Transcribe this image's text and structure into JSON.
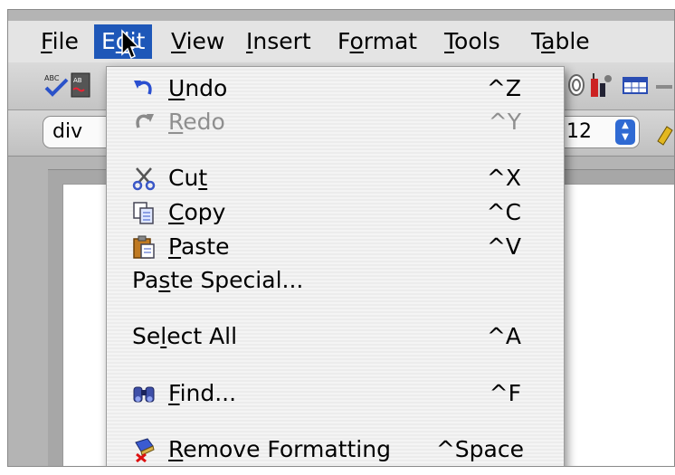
{
  "menubar": {
    "items": [
      {
        "pre": "",
        "u": "F",
        "post": "ile"
      },
      {
        "pre": "E",
        "u": "d",
        "post": "it"
      },
      {
        "pre": "",
        "u": "V",
        "post": "iew"
      },
      {
        "pre": "",
        "u": "I",
        "post": "nsert"
      },
      {
        "pre": "F",
        "u": "o",
        "post": "rmat"
      },
      {
        "pre": "",
        "u": "T",
        "post": "ools"
      },
      {
        "pre": "T",
        "u": "a",
        "post": "ble"
      }
    ],
    "active_index": 1
  },
  "toolbar": {
    "style_value": "div",
    "font_size_value": "12"
  },
  "edit_menu": {
    "items": [
      {
        "icon": "undo-icon",
        "pre": "",
        "u": "U",
        "post": "ndo",
        "shortcut": "^Z",
        "enabled": true
      },
      {
        "icon": "redo-icon",
        "pre": "",
        "u": "R",
        "post": "edo",
        "shortcut": "^Y",
        "enabled": false
      },
      {
        "icon": "scissors-icon",
        "pre": "Cu",
        "u": "t",
        "post": "",
        "shortcut": "^X",
        "enabled": true
      },
      {
        "icon": "copy-icon",
        "pre": "",
        "u": "C",
        "post": "opy",
        "shortcut": "^C",
        "enabled": true
      },
      {
        "icon": "clipboard-icon",
        "pre": "",
        "u": "P",
        "post": "aste",
        "shortcut": "^V",
        "enabled": true
      },
      {
        "icon": "",
        "pre": "Pa",
        "u": "s",
        "post": "te Special...",
        "shortcut": "",
        "enabled": true
      },
      {
        "icon": "",
        "pre": "Se",
        "u": "l",
        "post": "ect All",
        "shortcut": "^A",
        "enabled": true
      },
      {
        "icon": "binoculars-icon",
        "pre": "",
        "u": "F",
        "post": "ind...",
        "shortcut": "^F",
        "enabled": true
      },
      {
        "icon": "eraser-icon",
        "pre": "",
        "u": "R",
        "post": "emove Formatting",
        "shortcut": "^Space",
        "enabled": true
      }
    ]
  }
}
